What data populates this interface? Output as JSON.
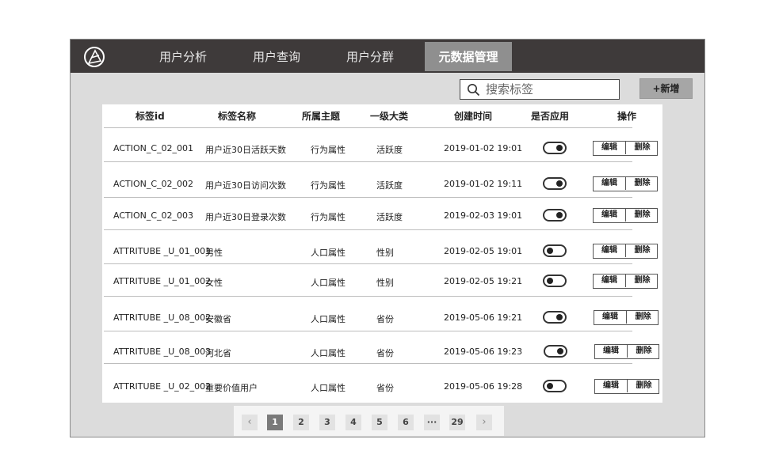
{
  "nav": {
    "items": [
      {
        "label": "用户分析"
      },
      {
        "label": "用户查询"
      },
      {
        "label": "用户分群"
      },
      {
        "label": "元数据管理",
        "active": true
      }
    ]
  },
  "search": {
    "placeholder": "搜索标签",
    "value": ""
  },
  "toolbar": {
    "add_label": "+新增"
  },
  "table": {
    "columns": [
      "标签id",
      "标签名称",
      "所属主题",
      "一级大类",
      "创建时间",
      "是否应用",
      "操作"
    ],
    "edit_label": "编辑",
    "delete_label": "删除",
    "rows": [
      {
        "id": "ACTION_C_02_001",
        "name": "用户近30日活跃天数",
        "theme": "行为属性",
        "category": "活跃度",
        "created": "2019-01-02 19:01",
        "applied": true
      },
      {
        "id": "ACTION_C_02_002",
        "name": "用户近30日访问次数",
        "theme": "行为属性",
        "category": "活跃度",
        "created": "2019-01-02 19:11",
        "applied": true
      },
      {
        "id": "ACTION_C_02_003",
        "name": "用户近30日登录次数",
        "theme": "行为属性",
        "category": "活跃度",
        "created": "2019-02-03 19:01",
        "applied": true
      },
      {
        "id": "ATTRITUBE _U_01_001",
        "name": "男性",
        "theme": "人口属性",
        "category": "性别",
        "created": "2019-02-05 19:01",
        "applied": false
      },
      {
        "id": "ATTRITUBE _U_01_002",
        "name": "女性",
        "theme": "人口属性",
        "category": "性别",
        "created": "2019-02-05 19:21",
        "applied": false
      },
      {
        "id": "ATTRITUBE _U_08_002",
        "name": "安徽省",
        "theme": "人口属性",
        "category": "省份",
        "created": "2019-05-06 19:21",
        "applied": true
      },
      {
        "id": "ATTRITUBE _U_08_003",
        "name": "河北省",
        "theme": "人口属性",
        "category": "省份",
        "created": "2019-05-06 19:23",
        "applied": true
      },
      {
        "id": "ATTRITUBE _U_02_002",
        "name": "重要价值用户",
        "theme": "人口属性",
        "category": "省份",
        "created": "2019-05-06 19:28",
        "applied": false
      }
    ]
  },
  "pagination": {
    "prev": "‹",
    "next": "›",
    "pages": [
      "1",
      "2",
      "3",
      "4",
      "5",
      "6",
      "···",
      "29"
    ],
    "current": "1"
  },
  "icons": {
    "logo": "logo-icon",
    "search": "search-icon"
  }
}
